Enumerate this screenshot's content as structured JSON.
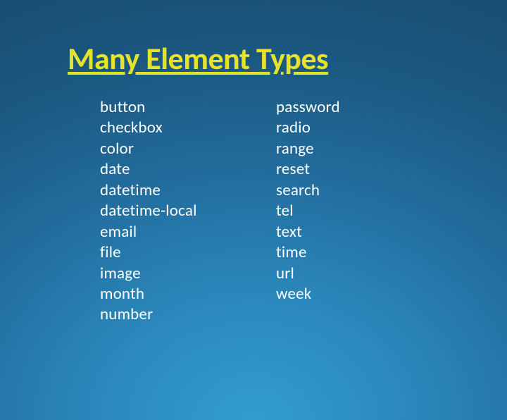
{
  "title": "Many Element Types",
  "leftColumn": [
    "button",
    "checkbox",
    "color",
    "date",
    "datetime",
    "datetime-local",
    "email",
    "file",
    "image",
    "month",
    "number"
  ],
  "rightColumn": [
    "password",
    "radio",
    "range",
    "reset",
    "search",
    "tel",
    "text",
    "time",
    "url",
    "week"
  ]
}
